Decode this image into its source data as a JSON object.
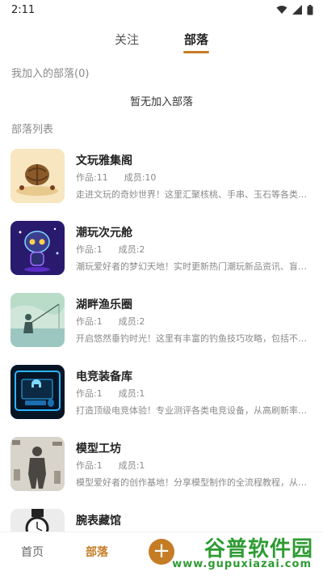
{
  "status_bar": {
    "time": "2:11",
    "icons": [
      "wifi-icon",
      "signal-icon",
      "battery-icon"
    ]
  },
  "top_tabs": [
    {
      "label": "关注",
      "active": false
    },
    {
      "label": "部落",
      "active": true
    }
  ],
  "joined_section": {
    "title": "我加入的部落(0)",
    "empty_text": "暂无加入部落"
  },
  "list_section": {
    "title": "部落列表"
  },
  "tribes": [
    {
      "name": "文玩雅集阁",
      "works": "作品:11",
      "members": "成员:10",
      "desc": "走进文玩的奇妙世界！这里汇聚核桃、手串、玉石等各类文...",
      "thumb": "walnut"
    },
    {
      "name": "潮玩次元舱",
      "works": "作品:1",
      "members": "成员:2",
      "desc": "潮玩爱好者的梦幻天地！实时更新热门潮玩新品资讯、盲盒...",
      "thumb": "toy"
    },
    {
      "name": "湖畔渔乐圈",
      "works": "作品:1",
      "members": "成员:2",
      "desc": "开启悠然垂钓时光！这里有丰富的钓鱼技巧攻略，包括不同...",
      "thumb": "fishing"
    },
    {
      "name": "电竞装备库",
      "works": "作品:1",
      "members": "成员:1",
      "desc": "打造顶级电竞体验！专业测评各类电竞设备，从高刷新率显...",
      "thumb": "esports"
    },
    {
      "name": "模型工坊",
      "works": "作品:1",
      "members": "成员:1",
      "desc": "模型爱好者的创作基地！分享模型制作的全流程教程，从素...",
      "thumb": "model"
    },
    {
      "name": "腕表藏馆",
      "works": "",
      "members": "",
      "desc": "",
      "thumb": "watch"
    }
  ],
  "bottom_nav": {
    "home": "首页",
    "tribe": "部落",
    "add": "+"
  },
  "watermark": {
    "title": "谷普软件园",
    "url": "www.gupuxiazai.com"
  },
  "colors": {
    "accent": "#c67c25",
    "watermark_green": "#2f9b34"
  }
}
